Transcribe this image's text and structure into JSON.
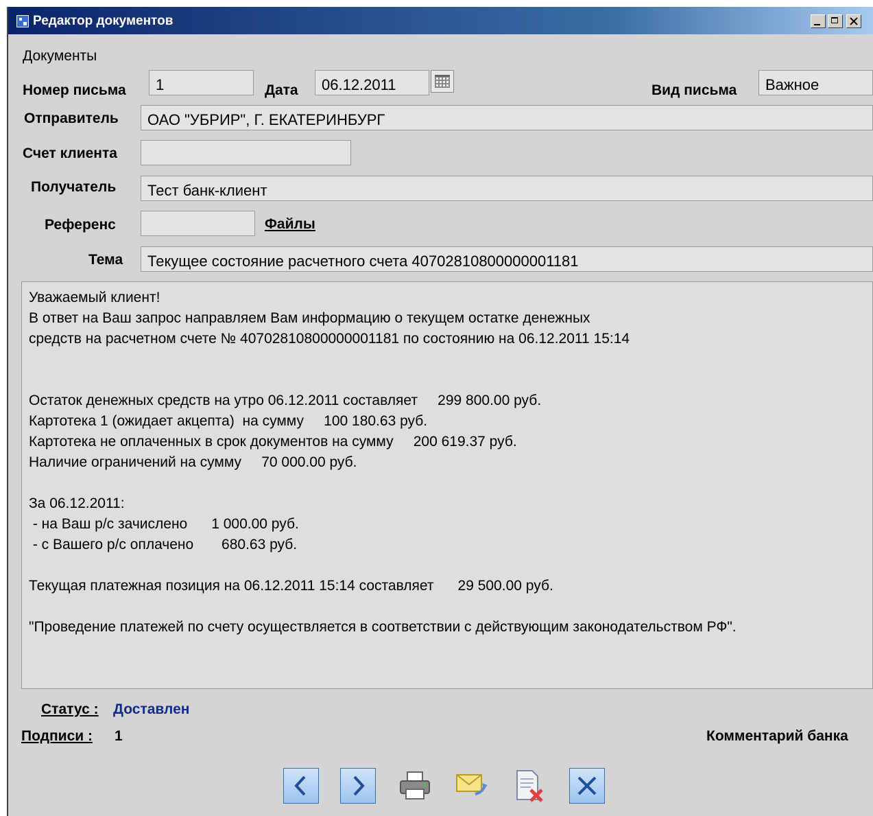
{
  "window": {
    "title": "Редактор документов"
  },
  "menu": {
    "documents": "Документы"
  },
  "form": {
    "number_label": "Номер письма",
    "number_value": "1",
    "date_label": "Дата",
    "date_value": "06.12.2011",
    "type_label": "Вид письма",
    "type_value": "Важное",
    "sender_label": "Отправитель",
    "sender_value": "ОАО \"УБРИР\", Г. ЕКАТЕРИНБУРГ",
    "account_label": "Счет клиента",
    "account_value": "",
    "recipient_label": "Получатель",
    "recipient_value": "Тест банк-клиент",
    "reference_label": "Референс",
    "reference_value": "",
    "files_link": "Файлы",
    "subject_label": "Тема",
    "subject_value": "Текущее состояние расчетного счета 40702810800000001181"
  },
  "body": {
    "lines": [
      "Уважаемый клиент!",
      "В ответ на Ваш запрос направляем Вам информацию о текущем остатке денежных",
      "средств на расчетном счете № 40702810800000001181 по состоянию на 06.12.2011 15:14",
      "",
      "",
      "Остаток денежных средств на утро 06.12.2011 составляет     299 800.00 руб.",
      "Картотека 1 (ожидает акцепта)  на сумму     100 180.63 руб.",
      "Картотека не оплаченных в срок документов на сумму     200 619.37 руб.",
      "Наличие ограничений на сумму     70 000.00 руб.",
      "",
      "За 06.12.2011:",
      " - на Ваш р/с зачислено      1 000.00 руб.",
      " - с Вашего р/с оплачено       680.63 руб.",
      "",
      "Текущая платежная позиция на 06.12.2011 15:14 составляет      29 500.00 руб.",
      "",
      "\"Проведение платежей по счету осуществляется в соответствии с действующим законодательством РФ\"."
    ]
  },
  "footer": {
    "status_label": "Статус :",
    "status_value": "Доставлен",
    "status_color": "#102c90",
    "signatures_label": "Подписи :",
    "signatures_value": "1",
    "bank_comment": "Комментарий банка"
  },
  "toolbar": {
    "icons": [
      "prev-icon",
      "next-icon",
      "print-icon",
      "send-mail-icon",
      "delete-document-icon",
      "close-icon"
    ]
  }
}
